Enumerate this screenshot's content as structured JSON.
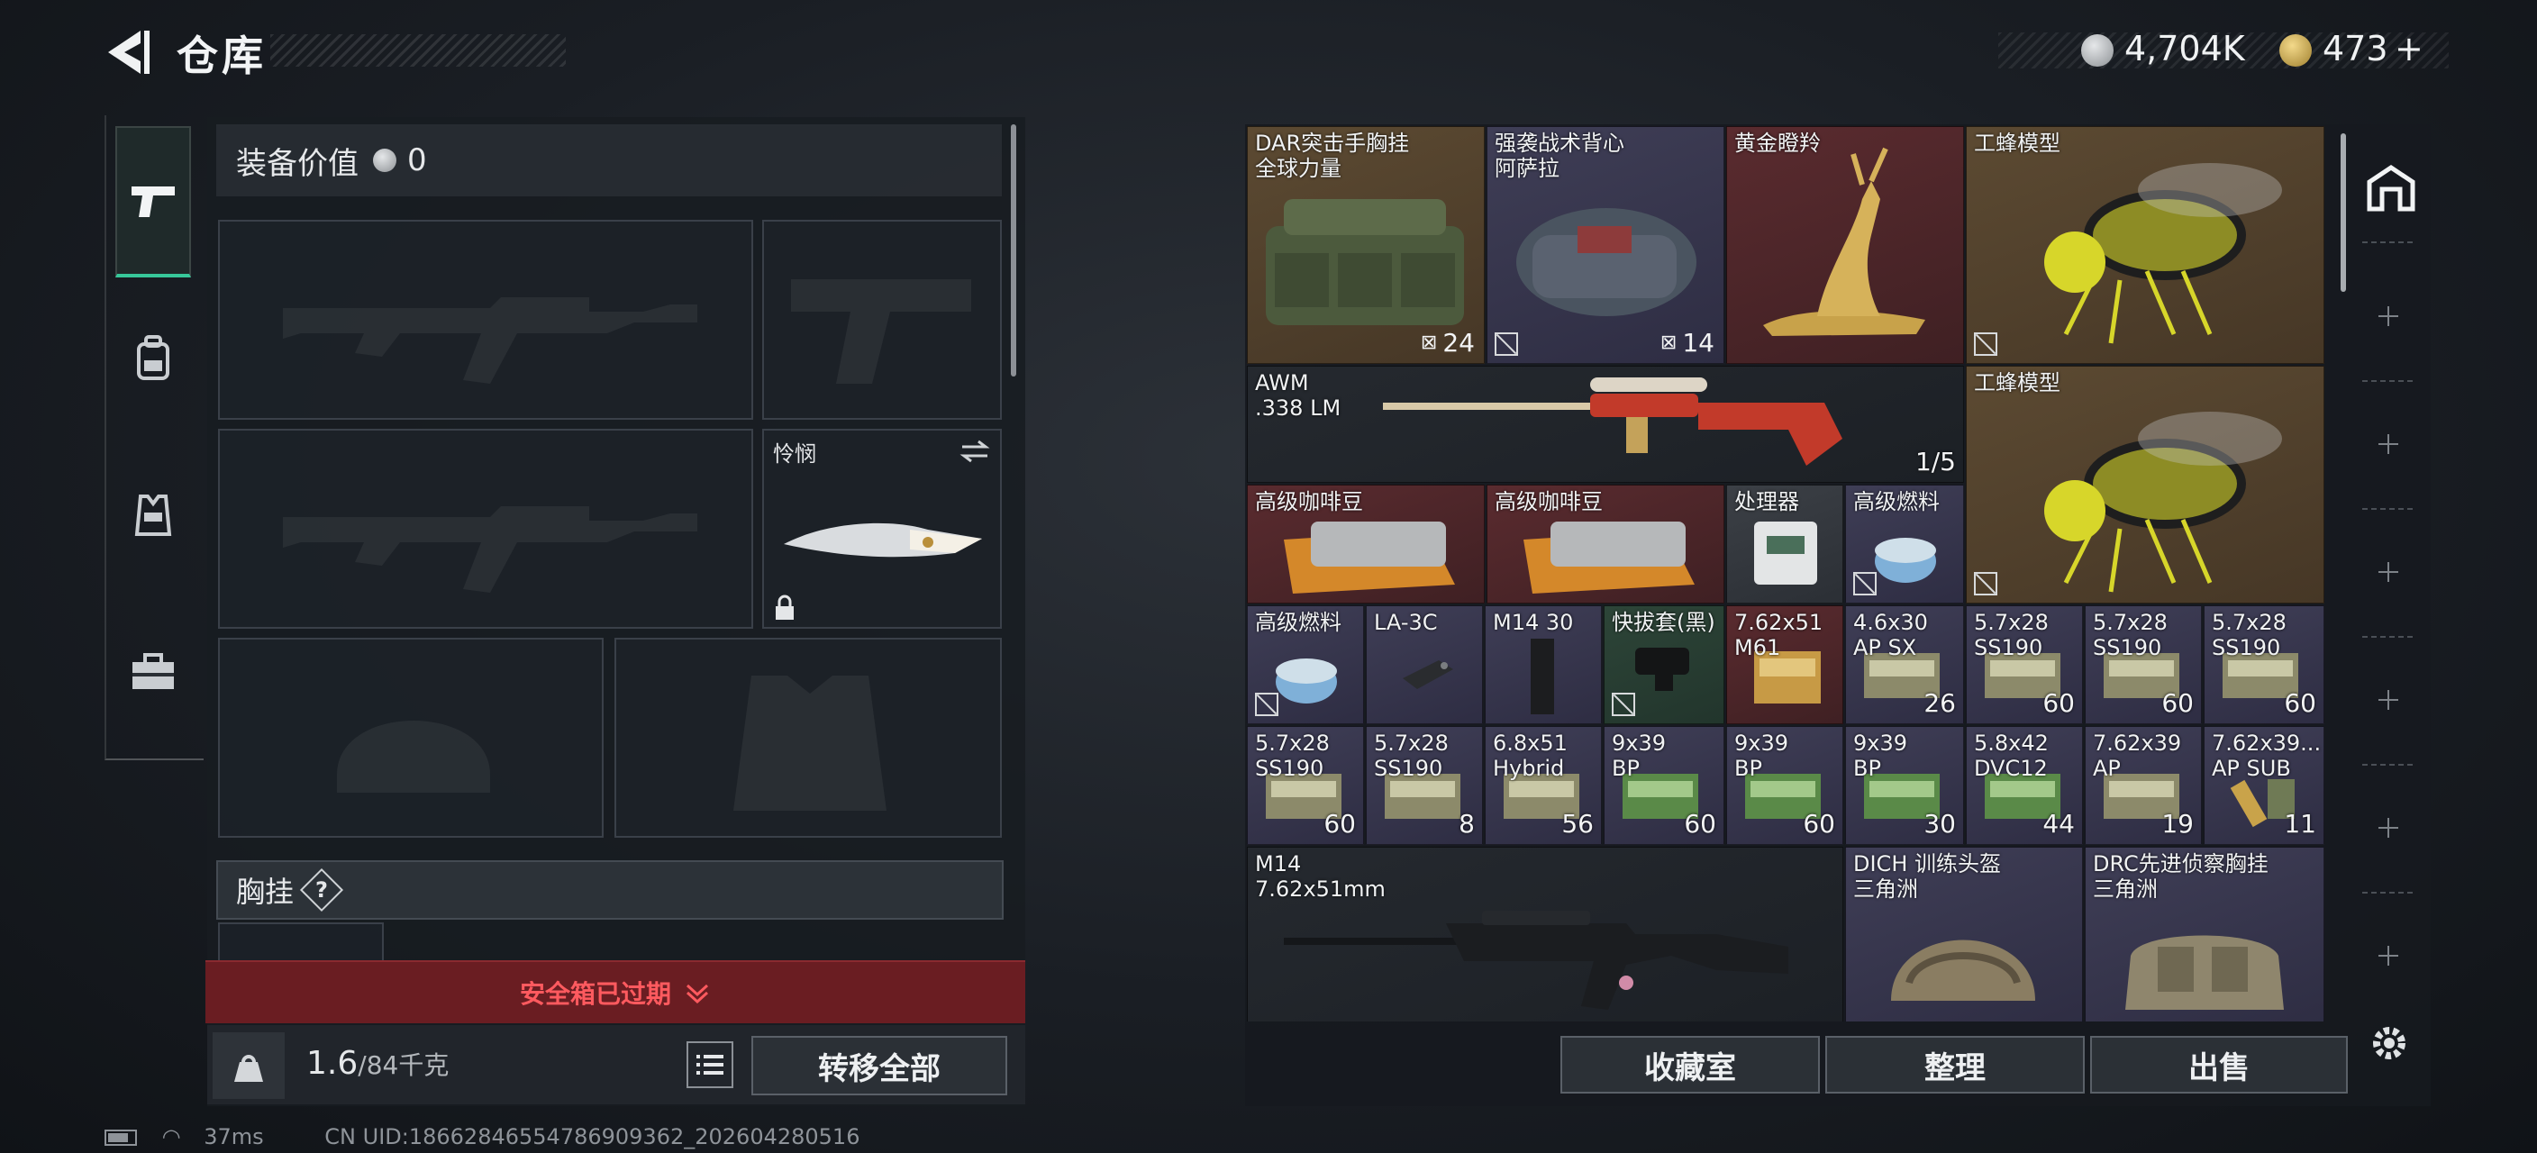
{
  "header": {
    "title": "仓库",
    "currency_primary": "4,704K",
    "currency_secondary": "473",
    "currency_secondary_add": "+"
  },
  "left_tabs": [
    "weapons-tab",
    "backpack-tab",
    "vest-tab",
    "toolbox-tab"
  ],
  "loadout": {
    "equip_value_label": "装备价值",
    "equip_value": "0",
    "melee_name": "怜悯",
    "chest_label": "胸挂",
    "chest_help": "?",
    "safebox_status": "安全箱已过期",
    "weight_current": "1.6",
    "weight_max": "/84千克",
    "transfer_all": "转移全部"
  },
  "storage": {
    "items": [
      {
        "name": "DAR突击手胸挂",
        "sub": "全球力量",
        "count": "24"
      },
      {
        "name": "强袭战术背心",
        "sub": "阿萨拉",
        "count": "14"
      },
      {
        "name": "黄金瞪羚"
      },
      {
        "name": "工蜂模型"
      },
      {
        "name": "AWM",
        "sub": ".338 LM",
        "count": "1/5"
      },
      {
        "name": "工蜂模型"
      },
      {
        "name": "高级咖啡豆"
      },
      {
        "name": "高级咖啡豆"
      },
      {
        "name": "处理器"
      },
      {
        "name": "高级燃料"
      },
      {
        "name": "高级燃料"
      },
      {
        "name": "LA-3C"
      },
      {
        "name": "M14 30"
      },
      {
        "name": "快拔套(黑)"
      },
      {
        "name": "7.62x51",
        "sub": "M61"
      },
      {
        "name": "4.6x30",
        "sub": "AP SX",
        "count": "26"
      },
      {
        "name": "5.7x28",
        "sub": "SS190",
        "count": "60"
      },
      {
        "name": "5.7x28",
        "sub": "SS190",
        "count": "60"
      },
      {
        "name": "5.7x28",
        "sub": "SS190",
        "count": "60"
      },
      {
        "name": "5.7x28",
        "sub": "SS190",
        "count": "60"
      },
      {
        "name": "5.7x28",
        "sub": "SS190",
        "count": "8"
      },
      {
        "name": "6.8x51",
        "sub": "Hybrid",
        "count": "56"
      },
      {
        "name": "9x39",
        "sub": "BP",
        "count": "60"
      },
      {
        "name": "9x39",
        "sub": "BP",
        "count": "60"
      },
      {
        "name": "9x39",
        "sub": "BP",
        "count": "30"
      },
      {
        "name": "5.8x42",
        "sub": "DVC12",
        "count": "44"
      },
      {
        "name": "7.62x39",
        "sub": "AP",
        "count": "19"
      },
      {
        "name": "7.62x39...",
        "sub": "AP SUB",
        "count": "11"
      },
      {
        "name": "M14",
        "sub": "7.62x51mm"
      },
      {
        "name": "DICH 训练头盔",
        "sub": "三角洲"
      },
      {
        "name": "DRC先进侦察胸挂",
        "sub": "三角洲"
      }
    ],
    "buttons": {
      "collection": "收藏室",
      "organize": "整理",
      "sell": "出售"
    }
  },
  "status_bar": {
    "ping": "37ms",
    "uid": "CN UID:18662846554786909362_202604280516"
  },
  "colors": {
    "accent": "#37c89a",
    "warning": "#ff5a5f",
    "warning_bg": "#6a1d22"
  }
}
